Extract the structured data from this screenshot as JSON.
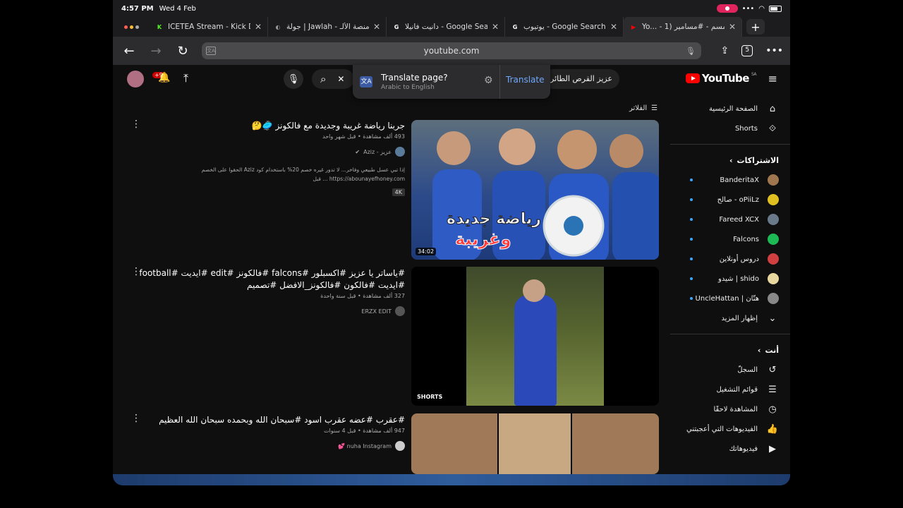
{
  "status": {
    "time": "4:57 PM",
    "date": "Wed 4 Feb"
  },
  "tabs": [
    {
      "title": "ICETEA Stream - Kick D",
      "favicon": "K",
      "color": "#53fc18"
    },
    {
      "title": "جولة | Jawlah - منصة الألـ",
      "favicon": "◐",
      "color": "#999999"
    },
    {
      "title": "دانيت فانيلا - Google Search",
      "favicon": "G",
      "color": "#ffffff"
    },
    {
      "title": "يوتيوب - Google Search",
      "favicon": "G",
      "color": "#ffffff"
    },
    {
      "title": "Yo... - سمسم - #مسامير (1",
      "favicon": "▶",
      "color": "#ff0000",
      "active": true
    }
  ],
  "address": {
    "url": "youtube.com",
    "tab_count": "5"
  },
  "header": {
    "notif_count": "+9",
    "search_chip": "عزيز القرص الطائر",
    "logo": "YouTube",
    "region": "SA"
  },
  "translate": {
    "title": "Translate page?",
    "subtitle": "Arabic to English",
    "button": "Translate"
  },
  "filter_label": "الفلاتر",
  "sidebar": {
    "main": [
      {
        "label": "الصفحة الرئيسية",
        "icon": "home-icon"
      },
      {
        "label": "Shorts",
        "icon": "shorts-icon"
      }
    ],
    "subs_heading": "الاشتراكات",
    "subs": [
      {
        "label": "BanderitaX",
        "color": "#a0764e"
      },
      {
        "label": "صالح - oPiiLz",
        "color": "#e0c020"
      },
      {
        "label": "Fareed XCX",
        "color": "#6a7a8a"
      },
      {
        "label": "Falcons",
        "color": "#1db954"
      },
      {
        "label": "دروس أونلاين",
        "color": "#d04040"
      },
      {
        "label": "شيدو | shido",
        "color": "#e8d8a0"
      },
      {
        "label": "UncleHattan | هتّان",
        "color": "#888888"
      }
    ],
    "show_more": "إظهار المزيد",
    "you_heading": "أنت",
    "you": [
      {
        "label": "السجلّ",
        "icon": "history-icon"
      },
      {
        "label": "قوائم التشغيل",
        "icon": "playlist-icon"
      },
      {
        "label": "المشاهدة لاحقًا",
        "icon": "clock-icon"
      },
      {
        "label": "الفيديوهات التي أعجبتني",
        "icon": "thumbs-up-icon"
      },
      {
        "label": "فيديوهاتك",
        "icon": "video-icon"
      }
    ]
  },
  "results": [
    {
      "title": "جربنا رياضة غريبة وجديدة مع فالكونز 🥏🤔",
      "stats": "493 ألف مشاهدة • قبل شهر واحد",
      "channel": "عزيز - Aziz",
      "desc": "إذا تبي عسل طبيعي وفاخر... لا تدور غيره خصم 20% باستخدام كود Aziz الحقوا على الخصم https://abounayefhoney.com ... قبل",
      "badge": "4K",
      "duration": "34:02",
      "thumb_text_1": "رياضة جديدة",
      "thumb_text_2": "وغريبة"
    },
    {
      "title": "#ياساتر يا عزيز #اكسبلور #falcons #فالكونز #edit #ايديت #football #ايديت #فالكون #فالكونز_الافضل #تصميم",
      "stats": "327 ألف مشاهدة • قبل سنة واحدة",
      "channel": "ERZX EDIT",
      "shorts_label": "SHORTS"
    },
    {
      "title": "#عقرب #عضه عقرب اسود #سبحان الله وبحمده سبحان الله العظيم",
      "stats": "947 ألف مشاهدة • قبل 4 سنوات",
      "channel": "nuha Instagram 💕"
    }
  ]
}
